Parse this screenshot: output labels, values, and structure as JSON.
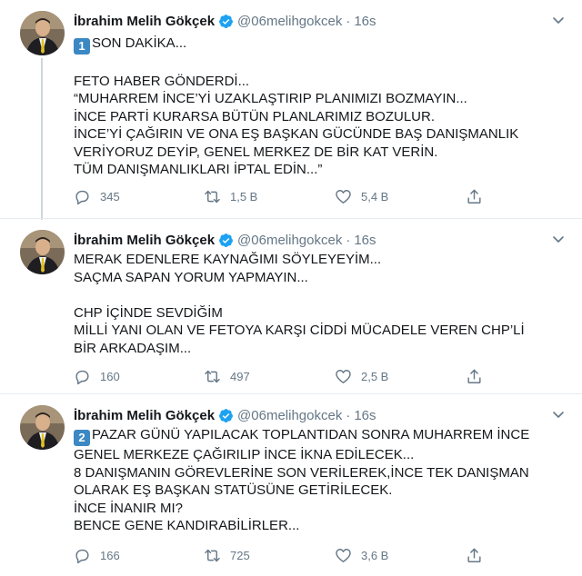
{
  "colors": {
    "text": "#14171a",
    "secondary": "#657786",
    "verified": "#1da1f2",
    "divider": "#e6ecf0",
    "keycap": "#3b88c3"
  },
  "tweets": [
    {
      "name": "İbrahim Melih Gökçek",
      "handle": "@06melihgokcek",
      "separator": "·",
      "time": "16s",
      "keycap": "1",
      "lines": [
        "SON DAKİKA...",
        "",
        "FETO HABER GÖNDERDİ...",
        "“MUHARREM İNCE’Yİ UZAKLAŞTIRIP PLANIMIZI BOZMAYIN...",
        "İNCE PARTİ KURARSA BÜTÜN PLANLARIMIZ BOZULUR.",
        "İNCE’Yİ ÇAĞIRIN VE ONA EŞ BAŞKAN GÜCÜNDE BAŞ DANIŞMANLIK",
        "VERİYORUZ DEYİP, GENEL MERKEZ DE BİR KAT VERİN.",
        "TÜM DANIŞMANLIKLARI İPTAL EDİN...”"
      ],
      "replies": "345",
      "retweets": "1,5 B",
      "likes": "5,4 B"
    },
    {
      "name": "İbrahim Melih Gökçek",
      "handle": "@06melihgokcek",
      "separator": "·",
      "time": "16s",
      "lines": [
        "MERAK EDENLERE KAYNAĞIMI SÖYLEYEYİM...",
        "SAÇMA SAPAN YORUM YAPMAYIN...",
        "",
        "CHP İÇİNDE SEVDİĞİM",
        "MİLLİ YANI OLAN VE FETOYA KARŞI CİDDİ MÜCADELE VEREN CHP’Lİ",
        "BİR ARKADAŞIM..."
      ],
      "replies": "160",
      "retweets": "497",
      "likes": "2,5 B"
    },
    {
      "name": "İbrahim Melih Gökçek",
      "handle": "@06melihgokcek",
      "separator": "·",
      "time": "16s",
      "keycap": "2",
      "lines": [
        "PAZAR GÜNÜ YAPILACAK TOPLANTIDAN SONRA MUHARREM İNCE",
        "GENEL MERKEZE ÇAĞIRILIP İNCE İKNA EDİLECEK...",
        "8 DANIŞMANIN GÖREVLERİNE SON VERİLEREK,İNCE TEK DANIŞMAN",
        "OLARAK EŞ BAŞKAN STATÜSÜNE GETİRİLECEK.",
        "İNCE İNANIR MI?",
        "BENCE GENE KANDIRABİLİRLER..."
      ],
      "replies": "166",
      "retweets": "725",
      "likes": "3,6 B"
    }
  ]
}
